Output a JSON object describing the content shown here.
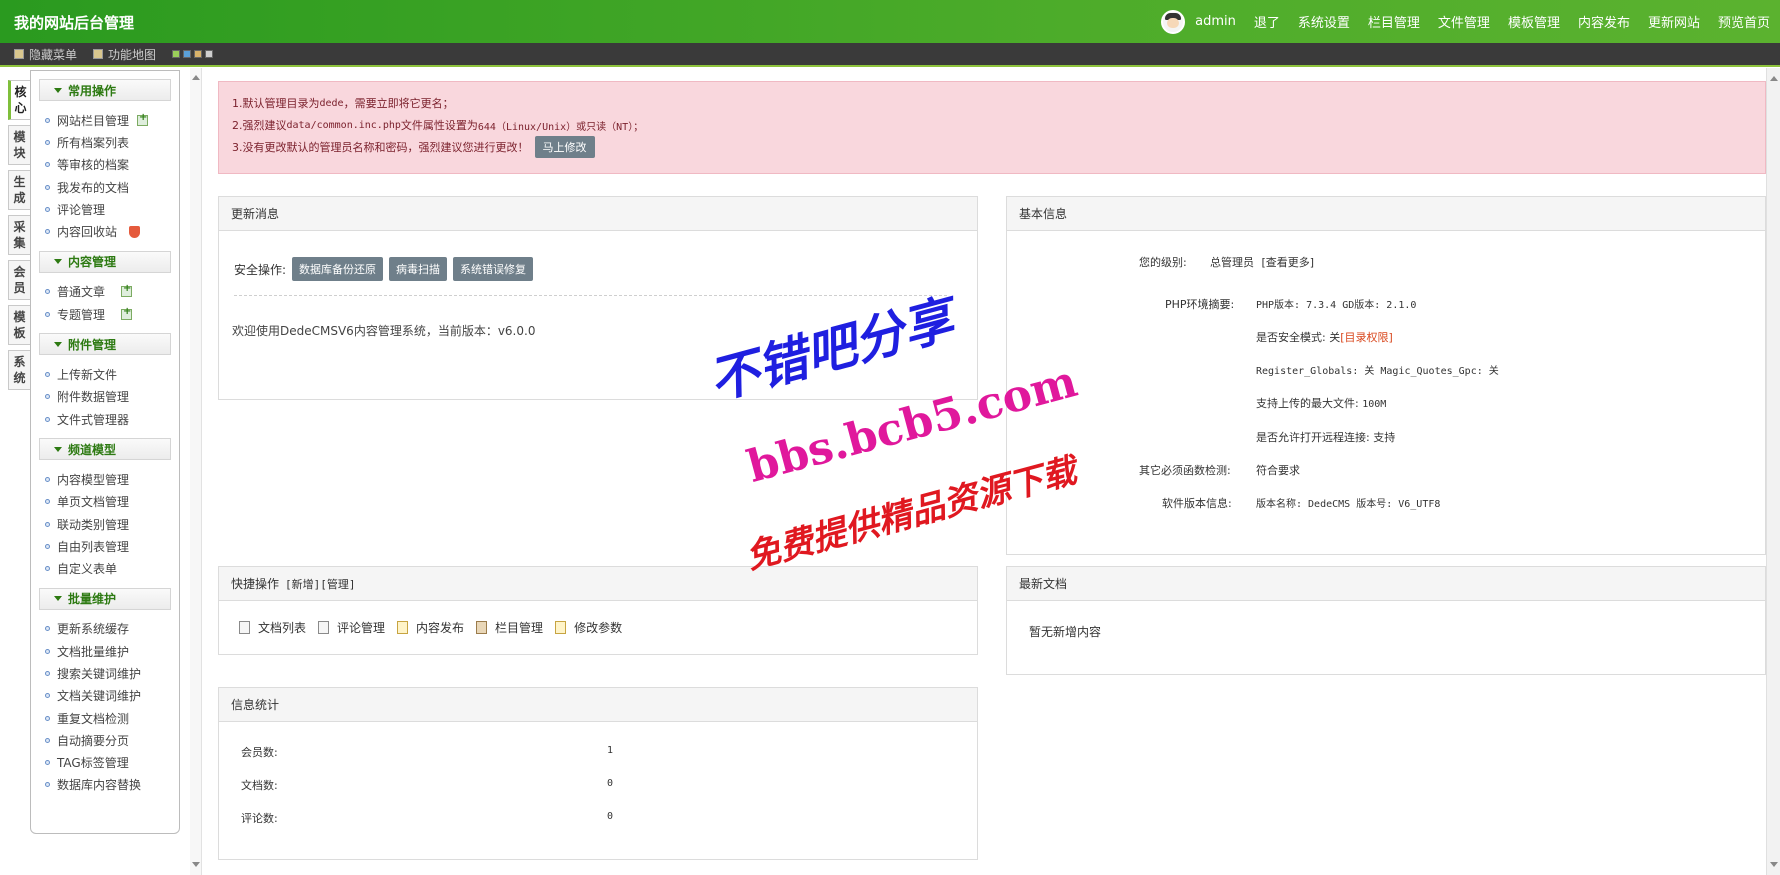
{
  "header": {
    "title": "我的网站后台管理",
    "user": "admin",
    "nav": [
      "退了",
      "系统设置",
      "栏目管理",
      "文件管理",
      "模板管理",
      "内容发布",
      "更新网站",
      "预览首页"
    ]
  },
  "subbar": {
    "hide_menu": "隐藏菜单",
    "func_map": "功能地图",
    "swatches": [
      "#9bcf5a",
      "#5aa0d8",
      "#d8b26a",
      "#cfcfcf"
    ]
  },
  "vtabs": [
    "核心",
    "模块",
    "生成",
    "采集",
    "会员",
    "模板",
    "系统"
  ],
  "sidebar": {
    "sections": [
      {
        "title": "常用操作",
        "items": [
          "网站栏目管理",
          "所有档案列表",
          "等审核的档案",
          "我发布的文档",
          "评论管理",
          "内容回收站"
        ]
      },
      {
        "title": "内容管理",
        "items": [
          "普通文章",
          "专题管理"
        ]
      },
      {
        "title": "附件管理",
        "items": [
          "上传新文件",
          "附件数据管理",
          "文件式管理器"
        ]
      },
      {
        "title": "频道模型",
        "items": [
          "内容模型管理",
          "单页文档管理",
          "联动类别管理",
          "自由列表管理",
          "自定义表单"
        ]
      },
      {
        "title": "批量维护",
        "items": [
          "更新系统缓存",
          "文档批量维护",
          "搜索关键词维护",
          "文档关键词维护",
          "重复文档检测",
          "自动摘要分页",
          "TAG标签管理",
          "数据库内容替换"
        ]
      }
    ]
  },
  "alert": {
    "line1_a": "1.默认管理目录为",
    "line1_b": "dede",
    "line1_c": "，需要立即将它更名；",
    "line2_a": "2.强烈建议",
    "line2_b": "data/common.inc.php",
    "line2_c": "文件属性设置为",
    "line2_d": "644（Linux/Unix）或只读（NT）；",
    "line3": "3.没有更改默认的管理员名称和密码，强烈建议您进行更改！",
    "button": "马上修改"
  },
  "news": {
    "title": "更新消息",
    "security_label": "安全操作:",
    "buttons": [
      "数据库备份还原",
      "病毒扫描",
      "系统错误修复"
    ],
    "welcome": "欢迎使用DedeCMSV6内容管理系统，当前版本：v6.0.0"
  },
  "basic": {
    "title": "基本信息",
    "level_label": "您的级别:",
    "level_value": "总管理员",
    "level_more": "[查看更多]",
    "env_label": "PHP环境摘要:",
    "php_version": "PHP版本: 7.3.4 GD版本: 2.1.0",
    "safe_mode": "是否安全模式: 关",
    "safe_link": "[目录权限]",
    "globals": "Register_Globals: 关 Magic_Quotes_Gpc: 关",
    "upload_max": "支持上传的最大文件: ",
    "upload_val": "100M",
    "remote": "是否允许打开远程连接: 支持",
    "func_label": "其它必须函数检测:",
    "func_value": "符合要求",
    "soft_label": "软件版本信息:",
    "soft_value": "版本名称: DedeCMS 版本号: V6_UTF8"
  },
  "quick": {
    "title": "快捷操作",
    "links": "[新增][管理]",
    "items": [
      "文档列表",
      "评论管理",
      "内容发布",
      "栏目管理",
      "修改参数"
    ]
  },
  "latest": {
    "title": "最新文档",
    "empty": "暂无新增内容"
  },
  "stats": {
    "title": "信息统计",
    "rows": [
      {
        "label": "会员数:",
        "value": "1"
      },
      {
        "label": "文档数:",
        "value": "0"
      },
      {
        "label": "评论数:",
        "value": "0"
      }
    ]
  },
  "watermark": {
    "line1": "不错吧分享",
    "line2": "bbs.bcb5.com",
    "line3": "免费提供精品资源下载",
    "colors": [
      "#1f1fe0",
      "#e0189c",
      "#e01820"
    ]
  }
}
